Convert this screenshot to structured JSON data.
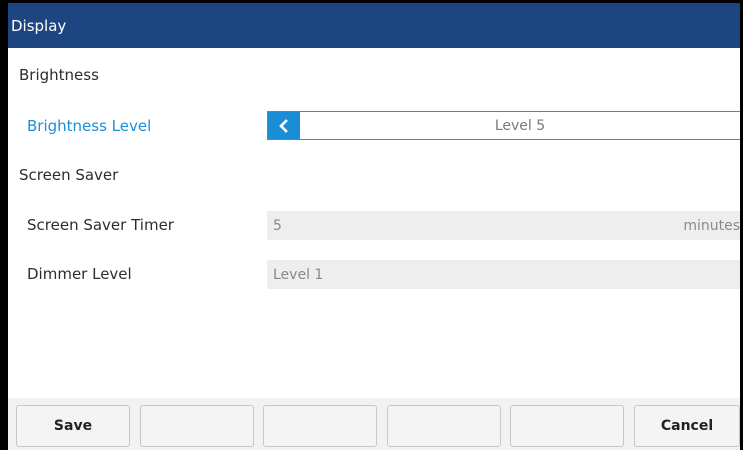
{
  "window": {
    "title": "Display"
  },
  "sections": {
    "brightness": {
      "label": "Brightness",
      "level_label": "Brightness Level",
      "level_value": "Level 5"
    },
    "screen_saver": {
      "label": "Screen Saver",
      "timer_label": "Screen Saver Timer",
      "timer_value": "5",
      "timer_unit": "minutes",
      "dimmer_label": "Dimmer Level",
      "dimmer_value": "Level 1"
    }
  },
  "softkeys": {
    "save": "Save",
    "cancel": "Cancel"
  },
  "colors": {
    "titlebar": "#1d4580",
    "accent": "#1b8cd6"
  },
  "icons": {
    "selector_arrow": "chevron-left-icon"
  }
}
